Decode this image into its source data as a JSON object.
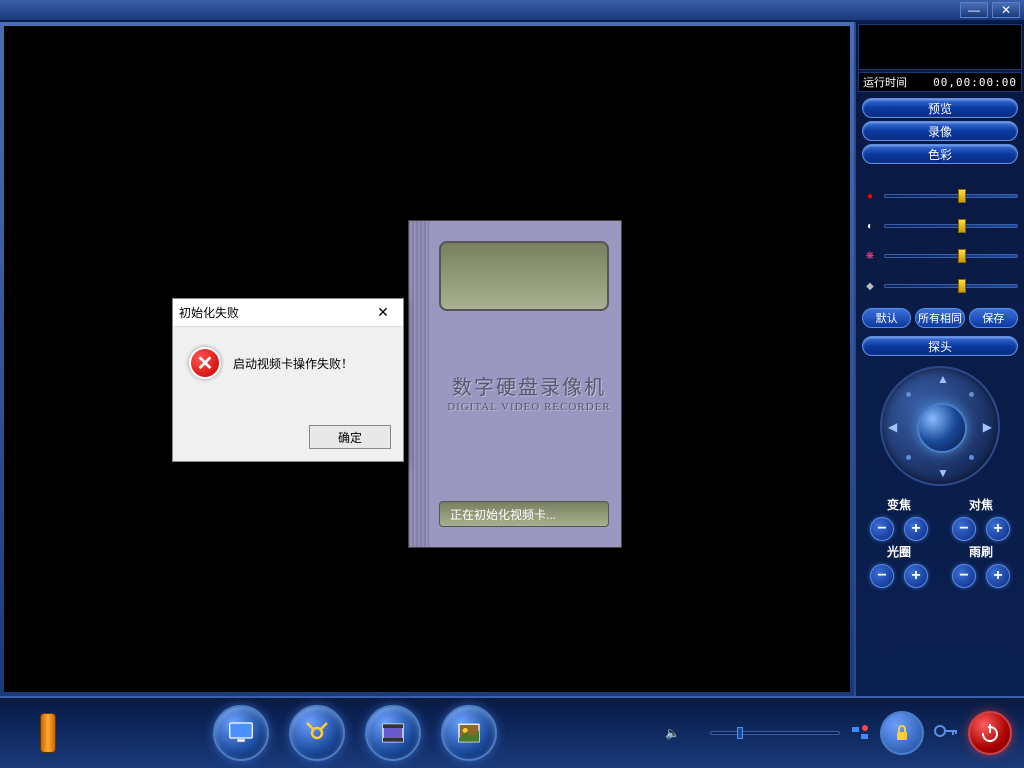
{
  "titlebar": {
    "minimize": "—",
    "close": "✕"
  },
  "splash": {
    "title_cn": "数字硬盘录像机",
    "title_en": "DIGITAL VIDEO RECORDER",
    "status": "正在初始化视频卡..."
  },
  "dialog": {
    "title": "初始化失败",
    "message": "启动视频卡操作失败！",
    "ok": "确定",
    "close": "✕"
  },
  "sidebar": {
    "runtime_label": "运行时间",
    "runtime_value": "00,00:00:00",
    "tabs": {
      "preview": "预览",
      "record": "录像",
      "color": "色彩"
    },
    "sliders": [
      {
        "icon": "●",
        "color": "#ff0000",
        "pos": 55
      },
      {
        "icon": "◐",
        "color": "#ffffff",
        "pos": 55
      },
      {
        "icon": "❋",
        "color": "#ff4488",
        "pos": 55
      },
      {
        "icon": "◆",
        "color": "#bbbbbb",
        "pos": 55
      }
    ],
    "small": {
      "default": "默认",
      "all_same": "所有相同",
      "save": "保存"
    },
    "probe": "探头",
    "controls": {
      "zoom": "变焦",
      "focus": "对焦",
      "iris": "光圈",
      "wiper": "雨刷",
      "minus": "−",
      "plus": "+"
    }
  },
  "bottombar": {
    "volume_icon": "🔈"
  }
}
